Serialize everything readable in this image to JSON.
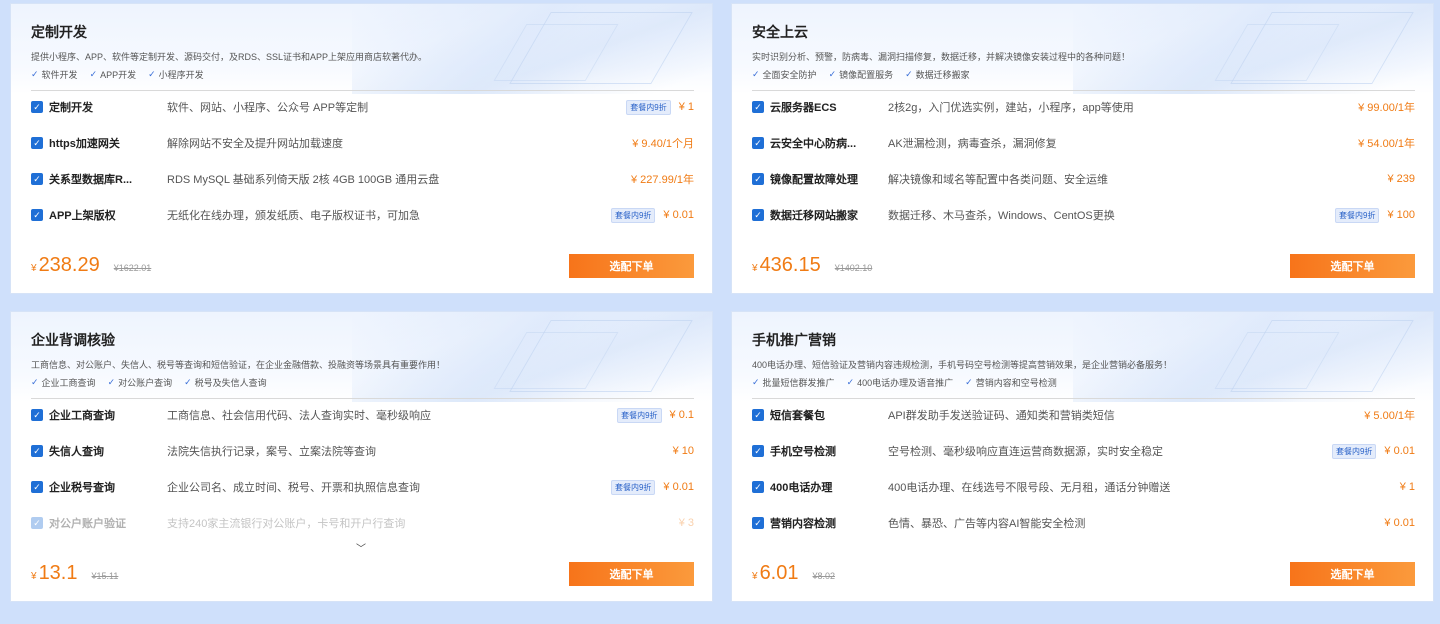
{
  "currency": "¥",
  "cards": [
    {
      "title": "定制开发",
      "desc": "提供小程序、APP、软件等定制开发、源码交付，及RDS、SSL证书和APP上架应用商店软著代办。",
      "tags": [
        "软件开发",
        "APP开发",
        "小程序开发"
      ],
      "rows": [
        {
          "name": "定制开发",
          "desc": "软件、网站、小程序、公众号 APP等定制",
          "badge": "套餐内9折",
          "price": "¥ 1"
        },
        {
          "name": "https加速网关",
          "desc": "解除网站不安全及提升网站加载速度",
          "badge": "",
          "price": "¥ 9.40/1个月"
        },
        {
          "name": "关系型数据库R...",
          "desc": "RDS MySQL 基础系列倚天版 2核 4GB 100GB 通用云盘",
          "badge": "",
          "price": "¥ 227.99/1年"
        },
        {
          "name": "APP上架版权",
          "desc": "无纸化在线办理，颁发纸质、电子版权证书，可加急",
          "badge": "套餐内9折",
          "price": "¥ 0.01"
        }
      ],
      "total": "238.29",
      "original": "¥1622.01",
      "button": "选配下单",
      "expand": ""
    },
    {
      "title": "安全上云",
      "desc": "实时识别分析、预警，防病毒、漏洞扫描修复，数据迁移，并解决镜像安装过程中的各种问题！",
      "tags": [
        "全面安全防护",
        "镜像配置服务",
        "数据迁移搬家"
      ],
      "rows": [
        {
          "name": "云服务器ECS",
          "desc": "2核2g，入门优选实例，建站，小程序，app等使用",
          "badge": "",
          "price": "¥ 99.00/1年"
        },
        {
          "name": "云安全中心防病...",
          "desc": "AK泄漏检测，病毒查杀，漏洞修复",
          "badge": "",
          "price": "¥ 54.00/1年"
        },
        {
          "name": "镜像配置故障处理",
          "desc": "解决镜像和域名等配置中各类问题、安全运维",
          "badge": "",
          "price": "¥ 239"
        },
        {
          "name": "数据迁移网站搬家",
          "desc": "数据迁移、木马查杀，Windows、CentOS更换",
          "badge": "套餐内9折",
          "price": "¥ 100"
        }
      ],
      "total": "436.15",
      "original": "¥1402.10",
      "button": "选配下单",
      "expand": ""
    },
    {
      "title": "企业背调核验",
      "desc": "工商信息、对公账户、失信人、税号等查询和短信验证，在企业金融借款、投融资等场景具有重要作用！",
      "tags": [
        "企业工商查询",
        "对公账户查询",
        "税号及失信人查询"
      ],
      "rows": [
        {
          "name": "企业工商查询",
          "desc": "工商信息、社会信用代码、法人查询实时、毫秒级响应",
          "badge": "套餐内9折",
          "price": "¥ 0.1"
        },
        {
          "name": "失信人查询",
          "desc": "法院失信执行记录，案号、立案法院等查询",
          "badge": "",
          "price": "¥ 10"
        },
        {
          "name": "企业税号查询",
          "desc": "企业公司名、成立时间、税号、开票和执照信息查询",
          "badge": "套餐内9折",
          "price": "¥ 0.01"
        },
        {
          "name": "对公户账户验证",
          "desc": "支持240家主流银行对公账户，卡号和开户行查询",
          "badge": "",
          "price": "¥ 3"
        }
      ],
      "total": "13.1",
      "original": "¥15.11",
      "button": "选配下单",
      "expand": "﹀"
    },
    {
      "title": "手机推广营销",
      "desc": "400电话办理、短信验证及营销内容违规检测，手机号码空号检测等提高营销效果，是企业营销必备服务！",
      "tags": [
        "批量短信群发推广",
        "400电话办理及语音推广",
        "营销内容和空号检测"
      ],
      "rows": [
        {
          "name": "短信套餐包",
          "desc": "API群发助手发送验证码、通知类和营销类短信",
          "badge": "",
          "price": "¥ 5.00/1年"
        },
        {
          "name": "手机空号检测",
          "desc": "空号检测、毫秒级响应直连运营商数据源，实时安全稳定",
          "badge": "套餐内9折",
          "price": "¥ 0.01"
        },
        {
          "name": "400电话办理",
          "desc": "400电话办理、在线选号不限号段、无月租，通话分钟赠送",
          "badge": "",
          "price": "¥ 1"
        },
        {
          "name": "营销内容检测",
          "desc": "色情、暴恐、广告等内容AI智能安全检测",
          "badge": "",
          "price": "¥ 0.01"
        }
      ],
      "total": "6.01",
      "original": "¥8.02",
      "button": "选配下单",
      "expand": ""
    }
  ]
}
